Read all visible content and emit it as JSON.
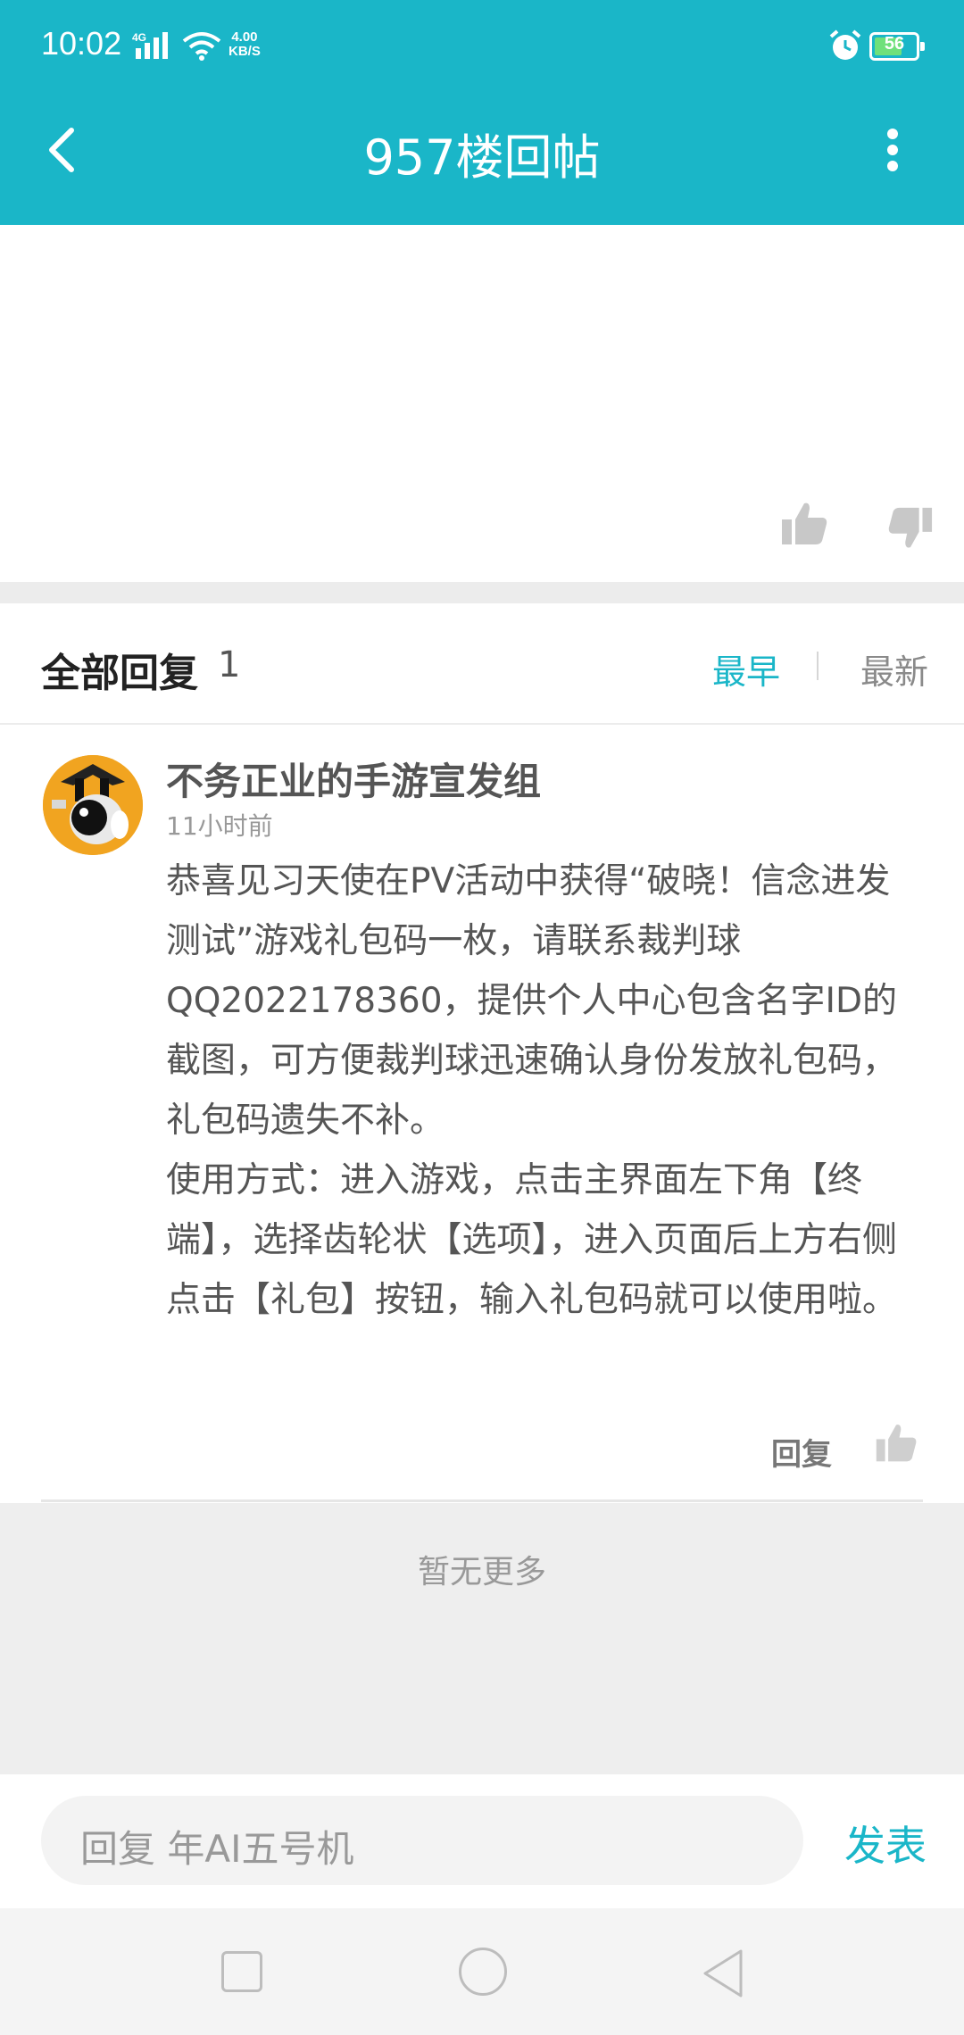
{
  "status_bar": {
    "time": "10:02",
    "network": "4G",
    "speed_value": "4.00",
    "speed_unit": "KB/S",
    "battery": "56",
    "accent": "#1ab6c8"
  },
  "app_bar": {
    "title": "957楼回帖",
    "back_icon": "chevron-left-icon",
    "more_icon": "more-vertical-icon"
  },
  "post": {
    "like_icon": "thumbs-up-icon",
    "dislike_icon": "thumbs-down-icon"
  },
  "replies": {
    "title": "全部回复",
    "count": "1",
    "sort_earliest": "最早",
    "sort_latest": "最新",
    "sort_active_color": "#1ab6c8"
  },
  "comment": {
    "author": "不务正业的手游宣发组",
    "time": "11小时前",
    "body": "恭喜见习天使在PV活动中获得“破晓！信念进发测试”游戏礼包码一枚，请联系裁判球QQ2022178360，提供个人中心包含名字ID的截图，可方便裁判球迅速确认身份发放礼包码，礼包码遗失不补。\n使用方式：进入游戏，点击主界面左下角【终端】，选择齿轮状【选项】，进入页面后上方右侧点击【礼包】按钮，输入礼包码就可以使用啦。",
    "reply_label": "回复"
  },
  "footer": {
    "no_more": "暂无更多"
  },
  "input_bar": {
    "placeholder": "回复 年AI五号机",
    "send_label": "发表"
  },
  "nav_bar": {
    "recent_icon": "square-icon",
    "home_icon": "circle-icon",
    "back_icon": "triangle-back-icon"
  }
}
